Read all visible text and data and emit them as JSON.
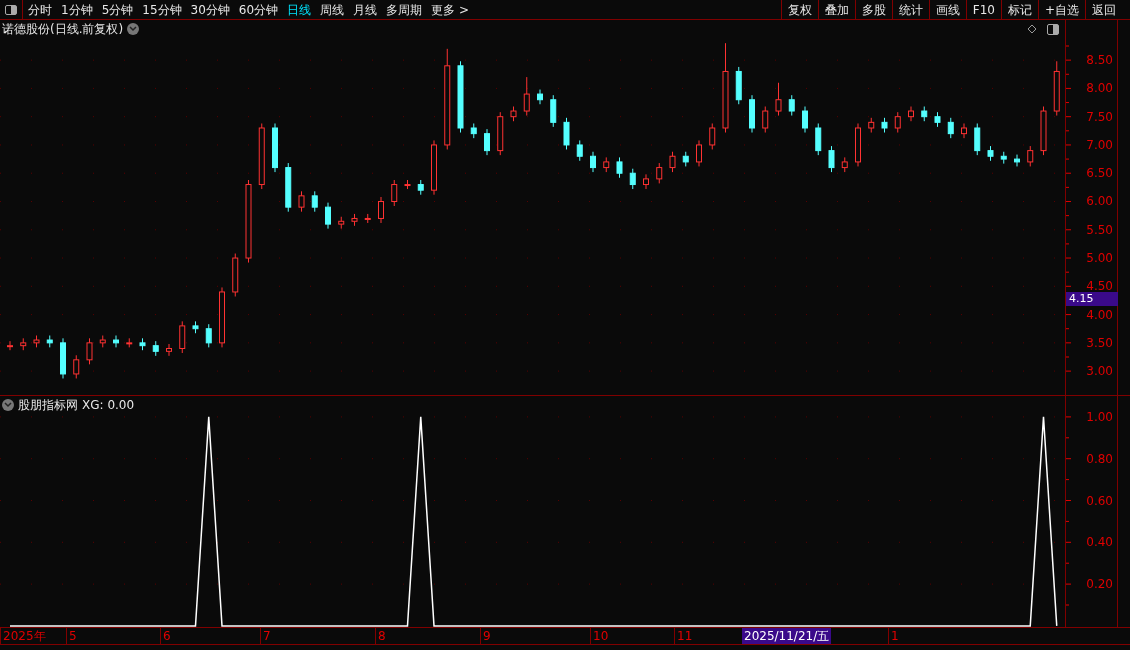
{
  "toolbar": {
    "periods": [
      {
        "label": "分时",
        "selected": false
      },
      {
        "label": "1分钟",
        "selected": false
      },
      {
        "label": "5分钟",
        "selected": false
      },
      {
        "label": "15分钟",
        "selected": false
      },
      {
        "label": "30分钟",
        "selected": false
      },
      {
        "label": "60分钟",
        "selected": false
      },
      {
        "label": "日线",
        "selected": true
      },
      {
        "label": "周线",
        "selected": false
      },
      {
        "label": "月线",
        "selected": false
      },
      {
        "label": "多周期",
        "selected": false
      },
      {
        "label": "更多 >",
        "selected": false
      }
    ],
    "buttons": [
      "复权",
      "叠加",
      "多股",
      "统计",
      "画线",
      "F10",
      "标记",
      "+自选",
      "返回"
    ]
  },
  "price_panel": {
    "title": "诺德股份(日线.前复权)",
    "cursor_price": "4.15",
    "chart_data": {
      "type": "candlestick",
      "ohlc": [
        [
          3.45,
          3.53,
          3.37,
          3.45
        ],
        [
          3.45,
          3.58,
          3.37,
          3.5
        ],
        [
          3.5,
          3.63,
          3.42,
          3.55
        ],
        [
          3.55,
          3.63,
          3.42,
          3.5
        ],
        [
          3.5,
          3.58,
          2.87,
          2.95
        ],
        [
          2.95,
          3.28,
          2.87,
          3.2
        ],
        [
          3.2,
          3.58,
          3.12,
          3.5
        ],
        [
          3.5,
          3.63,
          3.42,
          3.55
        ],
        [
          3.55,
          3.63,
          3.42,
          3.5
        ],
        [
          3.5,
          3.58,
          3.42,
          3.5
        ],
        [
          3.5,
          3.58,
          3.37,
          3.45
        ],
        [
          3.45,
          3.53,
          3.27,
          3.35
        ],
        [
          3.35,
          3.48,
          3.27,
          3.4
        ],
        [
          3.4,
          3.88,
          3.32,
          3.8
        ],
        [
          3.8,
          3.88,
          3.67,
          3.75
        ],
        [
          3.75,
          3.83,
          3.42,
          3.5
        ],
        [
          3.5,
          4.48,
          3.42,
          4.4
        ],
        [
          4.4,
          5.08,
          4.32,
          5.0
        ],
        [
          5.0,
          6.38,
          4.92,
          6.3
        ],
        [
          6.3,
          7.38,
          6.22,
          7.3
        ],
        [
          7.3,
          7.38,
          6.52,
          6.6
        ],
        [
          6.6,
          6.68,
          5.82,
          5.9
        ],
        [
          5.9,
          6.18,
          5.82,
          6.1
        ],
        [
          6.1,
          6.18,
          5.82,
          5.9
        ],
        [
          5.9,
          5.98,
          5.52,
          5.6
        ],
        [
          5.6,
          5.73,
          5.52,
          5.65
        ],
        [
          5.65,
          5.78,
          5.57,
          5.7
        ],
        [
          5.7,
          5.78,
          5.62,
          5.7
        ],
        [
          5.7,
          6.08,
          5.62,
          6.0
        ],
        [
          6.0,
          6.38,
          5.92,
          6.3
        ],
        [
          6.3,
          6.38,
          6.22,
          6.3
        ],
        [
          6.3,
          6.38,
          6.12,
          6.2
        ],
        [
          6.2,
          7.08,
          6.12,
          7.0
        ],
        [
          7.0,
          8.7,
          6.92,
          8.4
        ],
        [
          8.4,
          8.48,
          7.22,
          7.3
        ],
        [
          7.3,
          7.38,
          7.12,
          7.2
        ],
        [
          7.2,
          7.28,
          6.82,
          6.9
        ],
        [
          6.9,
          7.58,
          6.82,
          7.5
        ],
        [
          7.5,
          7.68,
          7.42,
          7.6
        ],
        [
          7.6,
          8.2,
          7.52,
          7.9
        ],
        [
          7.9,
          7.98,
          7.72,
          7.8
        ],
        [
          7.8,
          7.88,
          7.32,
          7.4
        ],
        [
          7.4,
          7.48,
          6.92,
          7.0
        ],
        [
          7.0,
          7.08,
          6.72,
          6.8
        ],
        [
          6.8,
          6.88,
          6.52,
          6.6
        ],
        [
          6.6,
          6.78,
          6.52,
          6.7
        ],
        [
          6.7,
          6.78,
          6.42,
          6.5
        ],
        [
          6.5,
          6.58,
          6.22,
          6.3
        ],
        [
          6.3,
          6.48,
          6.22,
          6.4
        ],
        [
          6.4,
          6.68,
          6.32,
          6.6
        ],
        [
          6.6,
          6.88,
          6.52,
          6.8
        ],
        [
          6.8,
          6.88,
          6.62,
          6.7
        ],
        [
          6.7,
          7.08,
          6.62,
          7.0
        ],
        [
          7.0,
          7.38,
          6.92,
          7.3
        ],
        [
          7.3,
          8.8,
          7.22,
          8.3
        ],
        [
          8.3,
          8.38,
          7.72,
          7.8
        ],
        [
          7.8,
          7.88,
          7.22,
          7.3
        ],
        [
          7.3,
          7.68,
          7.22,
          7.6
        ],
        [
          7.6,
          8.1,
          7.52,
          7.8
        ],
        [
          7.8,
          7.88,
          7.52,
          7.6
        ],
        [
          7.6,
          7.68,
          7.22,
          7.3
        ],
        [
          7.3,
          7.38,
          6.82,
          6.9
        ],
        [
          6.9,
          6.98,
          6.52,
          6.6
        ],
        [
          6.6,
          6.78,
          6.52,
          6.7
        ],
        [
          6.7,
          7.38,
          6.62,
          7.3
        ],
        [
          7.3,
          7.48,
          7.22,
          7.4
        ],
        [
          7.4,
          7.48,
          7.22,
          7.3
        ],
        [
          7.3,
          7.58,
          7.22,
          7.5
        ],
        [
          7.5,
          7.68,
          7.42,
          7.6
        ],
        [
          7.6,
          7.68,
          7.42,
          7.5
        ],
        [
          7.5,
          7.58,
          7.32,
          7.4
        ],
        [
          7.4,
          7.48,
          7.12,
          7.2
        ],
        [
          7.2,
          7.38,
          7.12,
          7.3
        ],
        [
          7.3,
          7.38,
          6.82,
          6.9
        ],
        [
          6.9,
          6.98,
          6.72,
          6.8
        ],
        [
          6.8,
          6.88,
          6.67,
          6.75
        ],
        [
          6.75,
          6.83,
          6.62,
          6.7
        ],
        [
          6.7,
          6.98,
          6.62,
          6.9
        ],
        [
          6.9,
          7.68,
          6.82,
          7.6
        ],
        [
          7.6,
          8.48,
          7.52,
          8.3
        ]
      ],
      "ylim": [
        2.56,
        9.21
      ],
      "grid": true,
      "yticks": [
        {
          "value": 3,
          "label": "3.00"
        },
        {
          "value": 3.5,
          "label": "3.50"
        },
        {
          "value": 4,
          "label": "4.00"
        },
        {
          "value": 4.5,
          "label": "4.50"
        },
        {
          "value": 5,
          "label": "5.00"
        },
        {
          "value": 5.5,
          "label": "5.50"
        },
        {
          "value": 6,
          "label": "6.00"
        },
        {
          "value": 6.5,
          "label": "6.50"
        },
        {
          "value": 7,
          "label": "7.00"
        },
        {
          "value": 7.5,
          "label": "7.50"
        },
        {
          "value": 8,
          "label": "8.00"
        },
        {
          "value": 8.5,
          "label": "8.50"
        }
      ]
    }
  },
  "indicator_panel": {
    "title": "股朋指标网",
    "reading": "XG: 0.00",
    "chart_data": {
      "type": "line",
      "values": [
        0,
        0,
        0,
        0,
        0,
        0,
        0,
        0,
        0,
        0,
        0,
        0,
        0,
        0,
        0,
        1,
        0,
        0,
        0,
        0,
        0,
        0,
        0,
        0,
        0,
        0,
        0,
        0,
        0,
        0,
        0,
        1,
        0,
        0,
        0,
        0,
        0,
        0,
        0,
        0,
        0,
        0,
        0,
        0,
        0,
        0,
        0,
        0,
        0,
        0,
        0,
        0,
        0,
        0,
        0,
        0,
        0,
        0,
        0,
        0,
        0,
        0,
        0,
        0,
        0,
        0,
        0,
        0,
        0,
        0,
        0,
        0,
        0,
        0,
        0,
        0,
        0,
        0,
        1,
        0
      ],
      "ylim": [
        -0.01,
        1.1
      ],
      "grid": true,
      "yticks": [
        {
          "value": 0.2,
          "label": "0.20"
        },
        {
          "value": 0.4,
          "label": "0.40"
        },
        {
          "value": 0.6,
          "label": "0.60"
        },
        {
          "value": 0.8,
          "label": "0.80"
        },
        {
          "value": 1.0,
          "label": "1.00"
        }
      ]
    }
  },
  "date_axis": {
    "labels": [
      "2025年",
      "5",
      "6",
      "7",
      "8",
      "9",
      "10",
      "11",
      "1"
    ],
    "cursor_date": "2025/11/21/五"
  }
}
